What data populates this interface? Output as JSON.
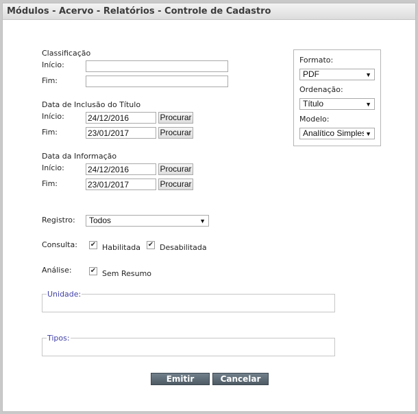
{
  "window": {
    "title": "Módulos - Acervo - Relatórios - Controle de Cadastro"
  },
  "classificacao": {
    "section_label": "Classificação",
    "inicio_label": "Início:",
    "inicio_value": "",
    "fim_label": "Fim:",
    "fim_value": ""
  },
  "data_inclusao": {
    "section_label": "Data de Inclusão do Título",
    "inicio_label": "Início:",
    "inicio_value": "24/12/2016",
    "fim_label": "Fim:",
    "fim_value": "23/01/2017",
    "search_label": "Procurar"
  },
  "data_informacao": {
    "section_label": "Data da Informação",
    "inicio_label": "Início:",
    "inicio_value": "24/12/2016",
    "fim_label": "Fim:",
    "fim_value": "23/01/2017",
    "search_label": "Procurar"
  },
  "output_panel": {
    "formato_label": "Formato:",
    "formato_value": "PDF",
    "ordenacao_label": "Ordenação:",
    "ordenacao_value": "Título",
    "modelo_label": "Modelo:",
    "modelo_value": "Analítico Simples"
  },
  "registro": {
    "label": "Registro:",
    "value": "Todos"
  },
  "consulta": {
    "label": "Consulta:",
    "habilitada_label": "Habilitada",
    "habilitada_checked": true,
    "desabilitada_label": "Desabilitada",
    "desabilitada_checked": true
  },
  "analise": {
    "label": "Análise:",
    "sem_resumo_label": "Sem Resumo",
    "sem_resumo_checked": true
  },
  "unidade": {
    "legend": "Unidade:"
  },
  "tipos": {
    "legend": "Tipos:"
  },
  "actions": {
    "emitir_label": "Emitir",
    "cancelar_label": "Cancelar"
  },
  "icons": {
    "dropdown": "chevron-down-icon",
    "checkbox": "checkmark-icon"
  },
  "colors": {
    "legend_text": "#3f3fa8",
    "dark_button": "#5e6c76"
  }
}
